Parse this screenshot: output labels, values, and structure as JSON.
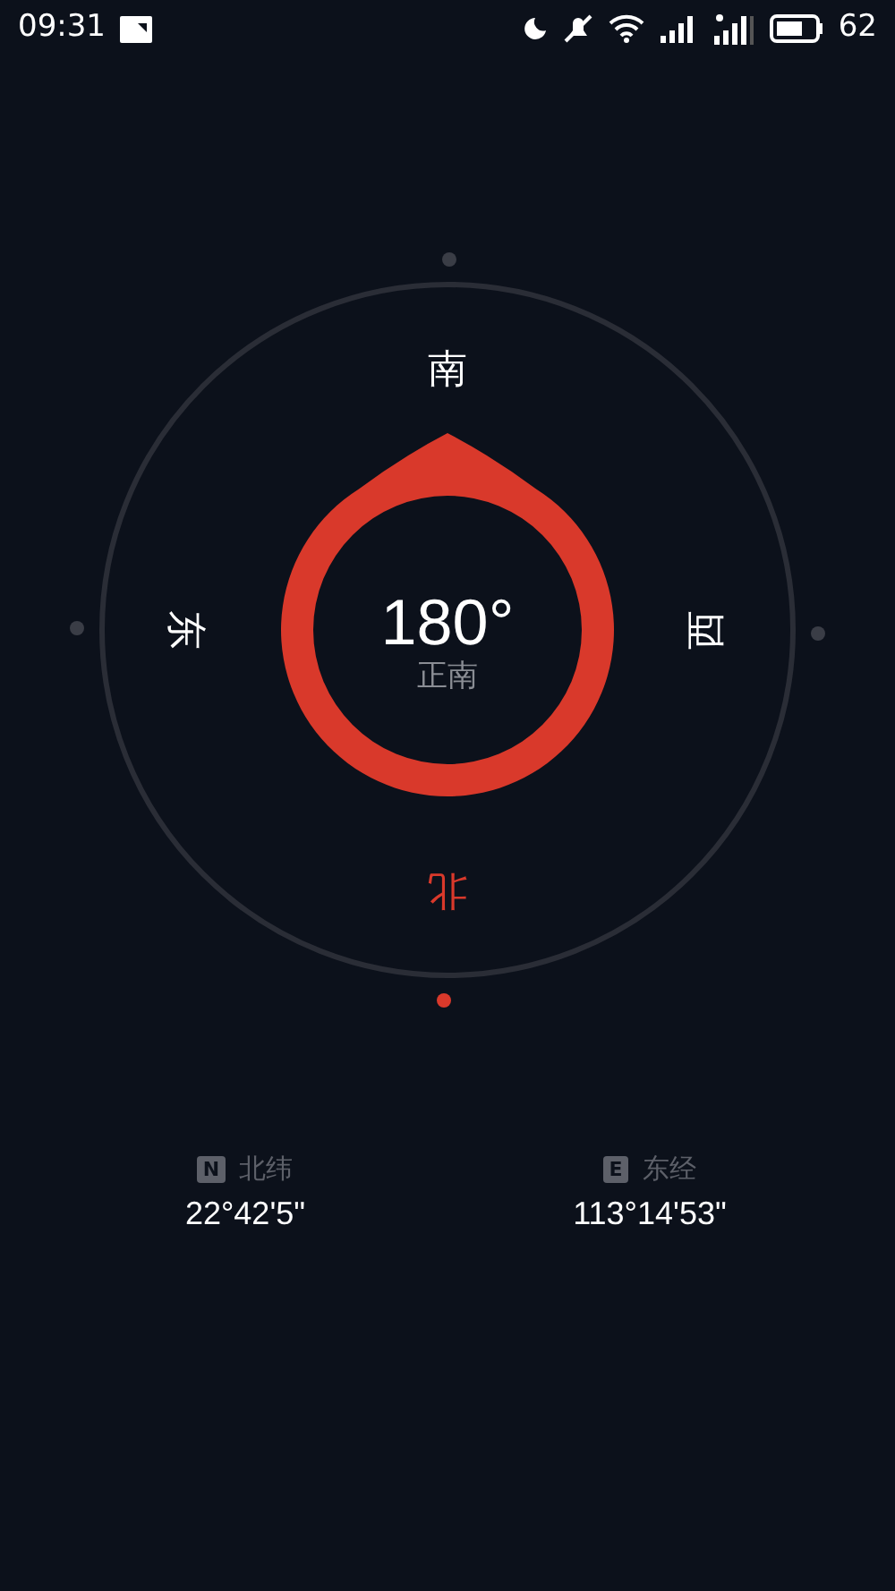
{
  "status_bar": {
    "time": "09:31",
    "battery": "62"
  },
  "compass": {
    "heading": "180°",
    "direction": "正南",
    "cardinals": [
      {
        "kind": "south",
        "label": "南",
        "highlighted": false
      },
      {
        "kind": "east",
        "label": "东",
        "highlighted": false
      },
      {
        "kind": "west",
        "label": "西",
        "highlighted": false
      },
      {
        "kind": "north",
        "label": "北",
        "highlighted": true
      }
    ]
  },
  "coordinates": [
    {
      "badge": "N",
      "label": "北纬",
      "value": "22°42'5\""
    },
    {
      "badge": "E",
      "label": "东经",
      "value": "113°14'53\""
    }
  ]
}
